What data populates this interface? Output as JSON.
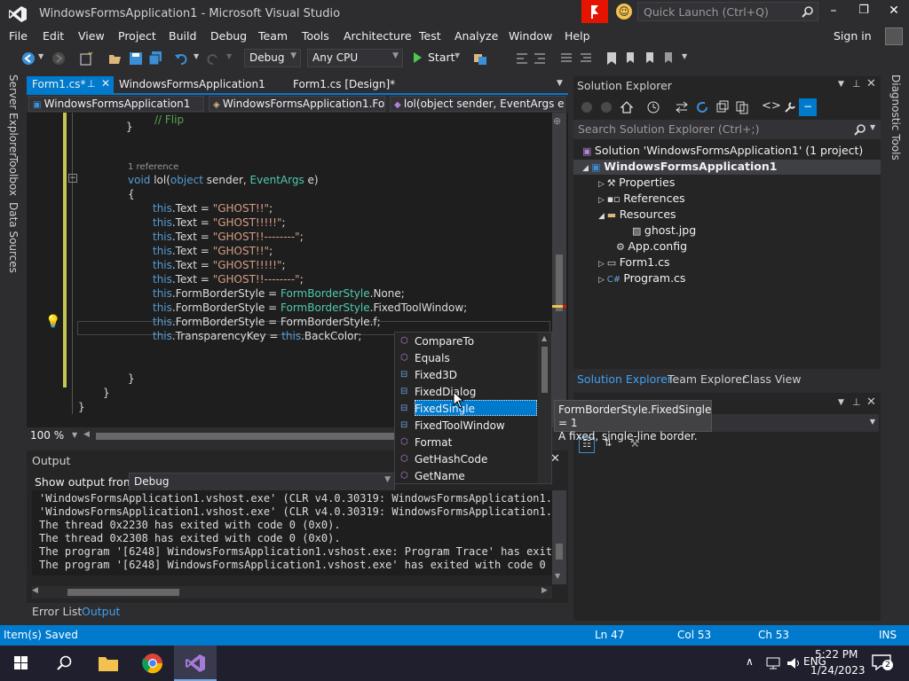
{
  "window": {
    "title": "WindowsFormsApplication1 - Microsoft Visual Studio",
    "quick_launch_placeholder": "Quick Launch (Ctrl+Q)"
  },
  "menu": [
    "File",
    "Edit",
    "View",
    "Project",
    "Build",
    "Debug",
    "Team",
    "Tools",
    "Architecture",
    "Test",
    "Analyze",
    "Window",
    "Help"
  ],
  "sign_in": "Sign in",
  "toolbar": {
    "config": "Debug",
    "platform": "Any CPU",
    "start": "Start"
  },
  "left_strip": [
    "Server Explorer",
    "Toolbox",
    "Data Sources"
  ],
  "right_strip": "Diagnostic Tools",
  "doc_tabs": [
    "Form1.cs*",
    "WindowsFormsApplication1",
    "Form1.cs [Design]*"
  ],
  "nav": {
    "project": "WindowsFormsApplication1",
    "class": "WindowsFormsApplication1.Fo",
    "member": "lol(object sender, EventArgs e)"
  },
  "code": {
    "codelens": "1 reference",
    "signature_kw": "void",
    "signature_name": " lol(",
    "signature_obj": "object",
    "signature_mid": " sender, ",
    "signature_type": "EventArgs",
    "signature_end": " e)",
    "brace_open": "{",
    "brace_close": "}",
    "lines": [
      {
        "pre": "this",
        "mid": ".Text = ",
        "val": "\"GHOST!!\"",
        "end": ";"
      },
      {
        "pre": "this",
        "mid": ".Text = ",
        "val": "\"GHOST!!!!!\"",
        "end": ";"
      },
      {
        "pre": "this",
        "mid": ".Text = ",
        "val": "\"GHOST!!--------\"",
        "end": ";"
      },
      {
        "pre": "this",
        "mid": ".Text = ",
        "val": "\"GHOST!!\"",
        "end": ";"
      },
      {
        "pre": "this",
        "mid": ".Text = ",
        "val": "\"GHOST!!!!!\"",
        "end": ";"
      },
      {
        "pre": "this",
        "mid": ".Text = ",
        "val": "\"GHOST!!--------\"",
        "end": ";"
      }
    ],
    "fbs_lines": [
      {
        "pre": "this",
        "mid": ".FormBorderStyle = ",
        "ty": "FormBorderStyle",
        "end": ".None;"
      },
      {
        "pre": "this",
        "mid": ".FormBorderStyle = ",
        "ty": "FormBorderStyle",
        "end": ".FixedToolWindow;"
      },
      {
        "pre": "this",
        "mid": ".FormBorderStyle = FormBorderStyle.f;",
        "ty": "",
        "end": ""
      }
    ],
    "transparency": {
      "pre": "this",
      "mid": ".TransparencyKey = ",
      "kw": "this",
      "end": ".BackColor;"
    }
  },
  "zoom": "100 %",
  "intellisense": [
    "CompareTo",
    "Equals",
    "Fixed3D",
    "FixedDialog",
    "FixedSingle",
    "FixedToolWindow",
    "Format",
    "GetHashCode",
    "GetName"
  ],
  "tooltip": {
    "line1": "FormBorderStyle.FixedSingle = 1",
    "line2": "A fixed, single-line border."
  },
  "output": {
    "title": "Output",
    "show_from_label": "Show output from:",
    "show_from_value": "Debug",
    "lines": [
      "'WindowsFormsApplication1.vshost.exe' (CLR v4.0.30319: WindowsFormsApplication1.vsho",
      "'WindowsFormsApplication1.vshost.exe' (CLR v4.0.30319: WindowsFormsApplication1.vsho",
      "The thread 0x2230 has exited with code 0 (0x0).",
      "The thread 0x2308 has exited with code 0 (0x0).",
      "The program '[6248] WindowsFormsApplication1.vshost.exe: Program Trace' has exited",
      "The program '[6248] WindowsFormsApplication1.vshost.exe' has exited with code 0 (0x"
    ]
  },
  "bottom_tabs": [
    "Error List",
    "Output"
  ],
  "solution_explorer": {
    "title": "Solution Explorer",
    "search_placeholder": "Search Solution Explorer (Ctrl+;)",
    "items": [
      "Solution 'WindowsFormsApplication1' (1 project)",
      "WindowsFormsApplication1",
      "Properties",
      "References",
      "Resources",
      "ghost.jpg",
      "App.config",
      "Form1.cs",
      "Program.cs"
    ],
    "tabs": [
      "Solution Explorer",
      "Team Explorer",
      "Class View"
    ]
  },
  "status": {
    "message": "Item(s) Saved",
    "ln": "Ln 47",
    "col": "Col 53",
    "ch": "Ch 53",
    "mode": "INS"
  },
  "clock": {
    "time": "5:22 PM",
    "date": "1/24/2023"
  },
  "notif_count": "2"
}
